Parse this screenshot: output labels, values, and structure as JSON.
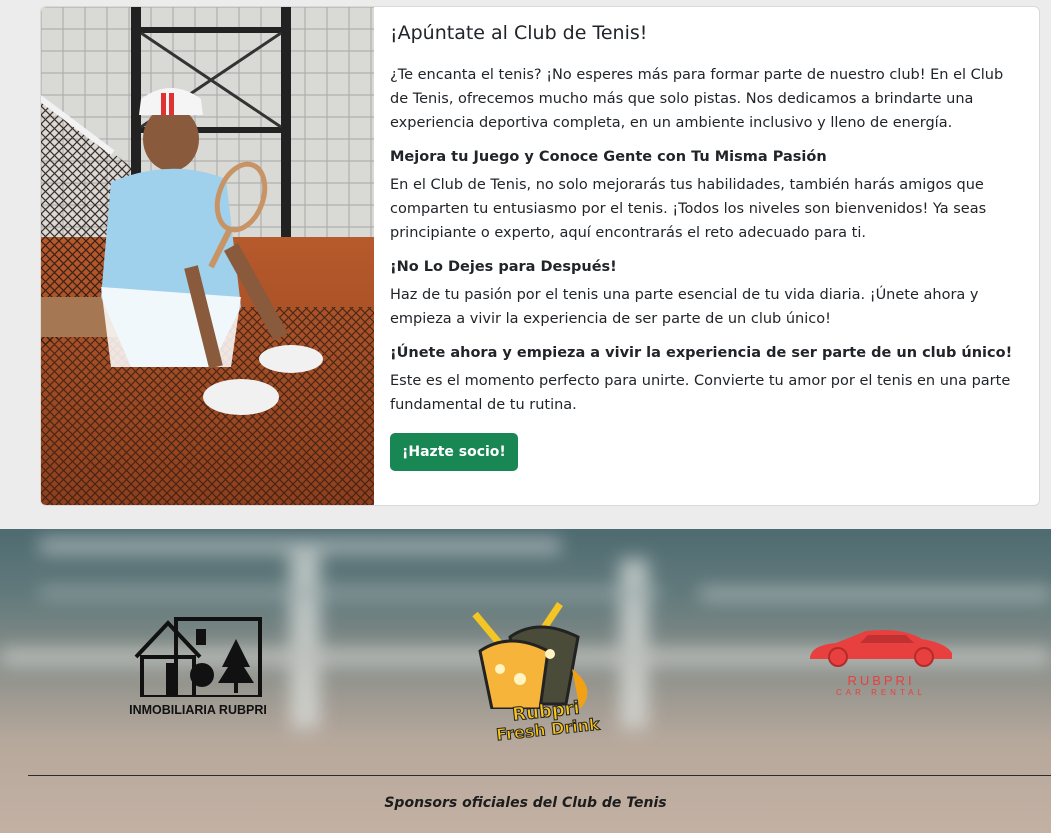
{
  "card": {
    "image_alt": "Tennis player sitting on a clay court",
    "title": "¡Apúntate al Club de Tenis!",
    "intro": "¿Te encanta el tenis? ¡No esperes más para formar parte de nuestro club! En el Club de Tenis, ofrecemos mucho más que solo pistas. Nos dedicamos a brindarte una experiencia deportiva completa, en un ambiente inclusivo y lleno de energía.",
    "sections": [
      {
        "heading": "Mejora tu Juego y Conoce Gente con Tu Misma Pasión",
        "text": "En el Club de Tenis, no solo mejorarás tus habilidades, también harás amigos que comparten tu entusiasmo por el tenis. ¡Todos los niveles son bienvenidos! Ya seas principiante o experto, aquí encontrarás el reto adecuado para ti."
      },
      {
        "heading": "¡No Lo Dejes para Después!",
        "text": "Haz de tu pasión por el tenis una parte esencial de tu vida diaria. ¡Únete ahora y empieza a vivir la experiencia de ser parte de un club único!"
      },
      {
        "heading": "¡Únete ahora y empieza a vivir la experiencia de ser parte de un club único!",
        "text": "Este es el momento perfecto para unirte. Convierte tu amor por el tenis en una parte fundamental de tu rutina."
      }
    ],
    "button_label": "¡Hazte socio!",
    "button_color": "#198754"
  },
  "sponsors": [
    {
      "name": "INMOBILIARIA RUBPRI"
    },
    {
      "name_line1": "Rubpri",
      "name_line2": "Fresh Drink"
    },
    {
      "name": "RUBPRI",
      "tagline": "CAR RENTAL",
      "color": "#e8403f"
    }
  ],
  "footer": {
    "caption": "Sponsors oficiales del Club de Tenis"
  }
}
